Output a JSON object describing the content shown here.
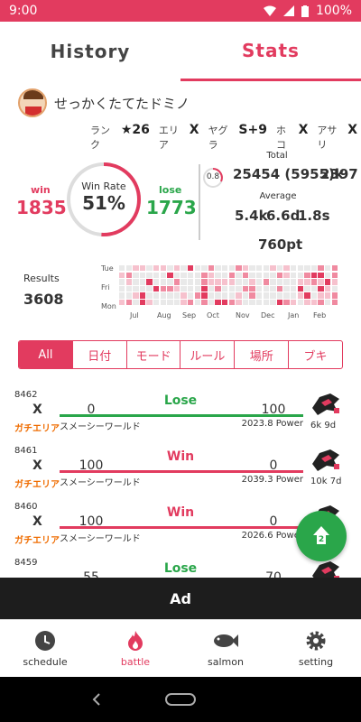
{
  "status": {
    "time": "9:00",
    "battery": "100%"
  },
  "tabs": {
    "history": "History",
    "stats": "Stats"
  },
  "player": {
    "name": "せっかくたてたドミノ",
    "ranks": [
      {
        "label": "ランク",
        "value": "★26"
      },
      {
        "label": "エリア",
        "value": "X"
      },
      {
        "label": "ヤグラ",
        "value": "S+9"
      },
      {
        "label": "ホコ",
        "value": "X"
      },
      {
        "label": "アサリ",
        "value": "X"
      }
    ]
  },
  "summary": {
    "win_label": "win",
    "win_value": "1835",
    "lose_label": "lose",
    "lose_value": "1773",
    "winrate_label": "Win Rate",
    "winrate_value": "51%",
    "winrate_fraction": 0.51,
    "kd_ratio": "0.8",
    "total_label": "Total",
    "total_kills": "25454 (5955)k",
    "total_deaths": "2397",
    "average_label": "Average",
    "avg_kills": "5.4k",
    "avg_deaths": "6.6d",
    "avg_special": "1.8s",
    "avg_points": "760pt"
  },
  "results": {
    "label": "Results",
    "value": "3608",
    "days": [
      "Tue",
      "Fri",
      "Mon"
    ],
    "months": [
      "Jul",
      "Aug",
      "Sep",
      "Oct",
      "Nov",
      "Dec",
      "Jan",
      "Feb"
    ]
  },
  "filters": [
    "All",
    "日付",
    "モード",
    "ルール",
    "場所",
    "ブキ"
  ],
  "battles": [
    {
      "id": "8462",
      "rank": "X",
      "mode": "ガチエリア",
      "result": "Lose",
      "score_left": "0",
      "score_right": "100",
      "stage": "スメーシーワールド",
      "power": "2023.8 Power",
      "kills": "6k",
      "deaths": "9d"
    },
    {
      "id": "8461",
      "rank": "X",
      "mode": "ガチエリア",
      "result": "Win",
      "score_left": "100",
      "score_right": "0",
      "stage": "スメーシーワールド",
      "power": "2039.3 Power",
      "kills": "10k",
      "deaths": "7d"
    },
    {
      "id": "8460",
      "rank": "X",
      "mode": "ガチエリア",
      "result": "Win",
      "score_left": "100",
      "score_right": "0",
      "stage": "スメーシーワールド",
      "power": "2026.6 Power",
      "kills": "",
      "deaths": ""
    },
    {
      "id": "8459",
      "rank": "",
      "mode": "",
      "result": "Lose",
      "score_left": "55",
      "score_right": "70",
      "stage": "",
      "power": "",
      "kills": "",
      "deaths": ""
    }
  ],
  "fab": {
    "label": "2"
  },
  "ad": {
    "label": "Ad"
  },
  "nav": [
    {
      "label": "schedule",
      "icon": "clock-icon"
    },
    {
      "label": "battle",
      "icon": "flame-icon"
    },
    {
      "label": "salmon",
      "icon": "fish-icon"
    },
    {
      "label": "setting",
      "icon": "gear-icon"
    }
  ],
  "colors": {
    "accent": "#e23b5f",
    "win": "#e23b5f",
    "lose": "#2aa64a",
    "mode": "#ef6c00"
  }
}
